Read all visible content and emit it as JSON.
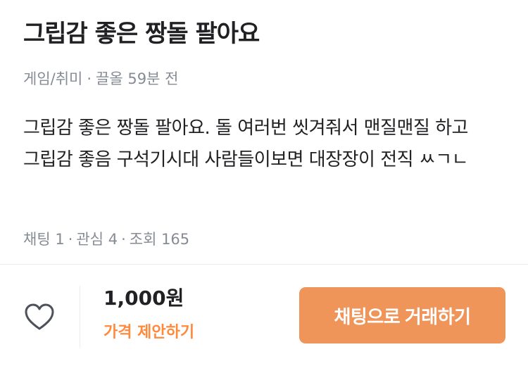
{
  "post": {
    "title": "그립감 좋은 짱돌 팔아요",
    "category": "게임/취미",
    "bumped": "끌올 59분 전",
    "description": "그립감 좋은 짱돌 팔아요. 돌 여러번 씻겨줘서 맨질맨질 하고 그립감 좋음 구석기시대 사람들이보면 대장장이 전직 ㅆㄱㄴ",
    "stats": {
      "chats": "채팅 1",
      "interests": "관심 4",
      "views": "조회 165"
    },
    "separator": "·"
  },
  "bottom_bar": {
    "price": "1,000원",
    "offer_label": "가격 제안하기",
    "chat_button_label": "채팅으로 거래하기",
    "icons": {
      "like": "heart-outline-icon"
    },
    "colors": {
      "accent": "#ff8a3d",
      "button": "#f0955a"
    }
  }
}
